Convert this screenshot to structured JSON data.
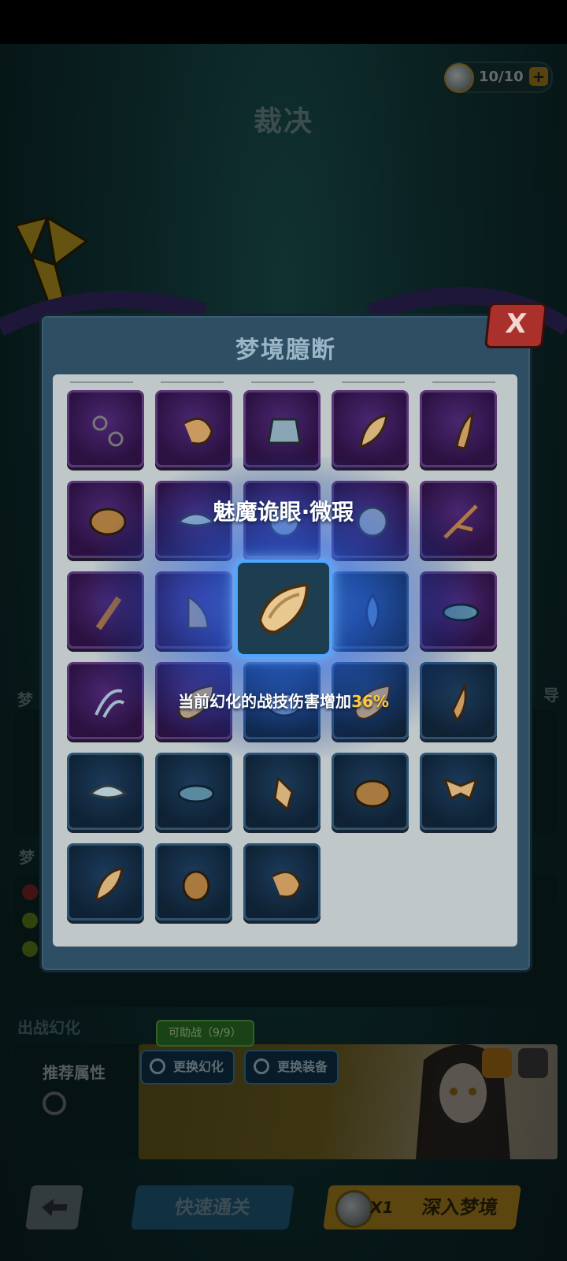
{
  "header": {
    "title": "裁决",
    "stamina_value": "10/10",
    "stamina_plus": "+"
  },
  "modal": {
    "title": "梦境臆断",
    "close_label": "X",
    "featured": {
      "name": "魅魔诡眼·微瑕",
      "desc_prefix": "当前幻化的战技伤害增加",
      "desc_value": "36%"
    },
    "slots": [
      {
        "rarity": "purple",
        "icon": "chain-icon"
      },
      {
        "rarity": "purple",
        "icon": "shrimp-icon"
      },
      {
        "rarity": "purple",
        "icon": "armor-icon"
      },
      {
        "rarity": "purple",
        "icon": "feather-icon"
      },
      {
        "rarity": "purple",
        "icon": "horn-icon"
      },
      {
        "rarity": "purple",
        "icon": "seed-icon"
      },
      {
        "rarity": "purple",
        "icon": "wing-icon"
      },
      {
        "rarity": "purple",
        "icon": "orb-icon"
      },
      {
        "rarity": "purple",
        "icon": "orb-icon"
      },
      {
        "rarity": "purple",
        "icon": "twig-icon"
      },
      {
        "rarity": "purple",
        "icon": "brush-icon"
      },
      {
        "rarity": "purple",
        "icon": "tooth-icon"
      },
      {
        "rarity": "blue",
        "icon": "eye-icon"
      },
      {
        "rarity": "blue",
        "icon": "flame-icon"
      },
      {
        "rarity": "purple",
        "icon": "eye-icon"
      },
      {
        "rarity": "purple",
        "icon": "claw-icon"
      },
      {
        "rarity": "purple",
        "icon": "crystal-icon"
      },
      {
        "rarity": "blue",
        "icon": "stone-icon"
      },
      {
        "rarity": "blue",
        "icon": "crystal-icon"
      },
      {
        "rarity": "blue",
        "icon": "fang-icon"
      },
      {
        "rarity": "blue",
        "icon": "wing-icon"
      },
      {
        "rarity": "blue",
        "icon": "eye-icon"
      },
      {
        "rarity": "blue",
        "icon": "shard-icon"
      },
      {
        "rarity": "blue",
        "icon": "seed-icon"
      },
      {
        "rarity": "blue",
        "icon": "moth-icon"
      },
      {
        "rarity": "blue",
        "icon": "feather-icon"
      },
      {
        "rarity": "blue",
        "icon": "beetle-icon"
      },
      {
        "rarity": "blue",
        "icon": "shrimp-icon"
      }
    ]
  },
  "background": {
    "section1_label": "梦",
    "section2_label": "梦",
    "deploy_label": "出战幻化",
    "recommend_label": "推荐属性",
    "assist_tag": "可助战（9/9）",
    "swap_illusion": "更换幻化",
    "swap_equip": "更换装备",
    "side_char": "导"
  },
  "footer": {
    "quick_clear": "快速通关",
    "dive_multiplier": "X1",
    "dive_label": "深入梦境"
  },
  "colors": {
    "accent_gold": "#ffc93c",
    "purple_slot": "#4a2670",
    "blue_slot": "#1b3a5a",
    "highlight_blue": "#4ea6ff",
    "close_red": "#a9302b"
  }
}
